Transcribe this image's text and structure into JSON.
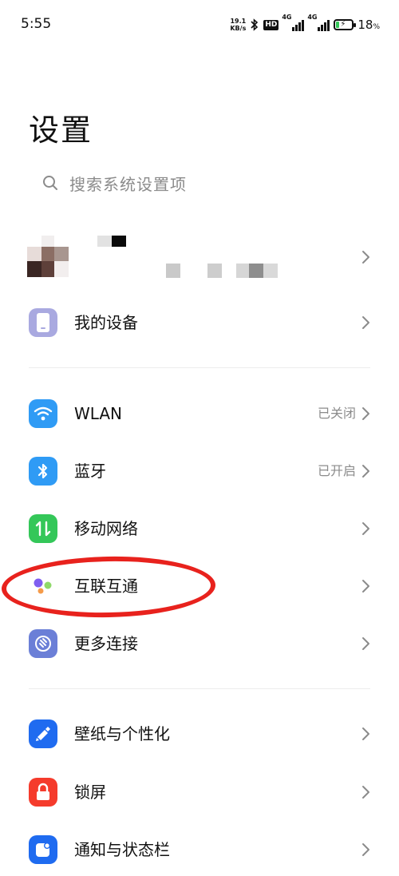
{
  "status_bar": {
    "time": "5:55",
    "net_speed_value": "19.1",
    "net_speed_unit": "KB/s",
    "hd_label": "HD",
    "sim1_gen": "4G",
    "sim2_gen": "4G",
    "battery_percent": "18",
    "battery_unit": "%",
    "battery_level": 0.18
  },
  "page": {
    "title": "设置"
  },
  "search": {
    "placeholder": "搜索系统设置项",
    "icon": "search-icon"
  },
  "rows": {
    "my_device": {
      "label": "我的设备",
      "icon": "phone-device-icon"
    },
    "wlan": {
      "label": "WLAN",
      "status": "已关闭",
      "icon": "wifi-icon",
      "color": "#2f9bf5"
    },
    "bluetooth": {
      "label": "蓝牙",
      "status": "已开启",
      "icon": "bluetooth-icon",
      "color": "#2f9bf5"
    },
    "mobile_network": {
      "label": "移动网络",
      "icon": "mobile-data-icon",
      "color": "#34c759"
    },
    "interconnect": {
      "label": "互联互通",
      "icon": "interconnect-dots-icon"
    },
    "more_connections": {
      "label": "更多连接",
      "icon": "link-icon",
      "color": "#6b7fd7"
    },
    "wallpaper": {
      "label": "壁纸与个性化",
      "icon": "brush-icon",
      "color": "#1f6bf0"
    },
    "lock_screen": {
      "label": "锁屏",
      "icon": "lock-icon",
      "color": "#f53b2c"
    },
    "notification": {
      "label": "通知与状态栏",
      "icon": "notification-icon",
      "color": "#1f6bf0"
    }
  },
  "colors": {
    "annotation": "#e8221d",
    "secondary_text": "#8b8b8b"
  }
}
